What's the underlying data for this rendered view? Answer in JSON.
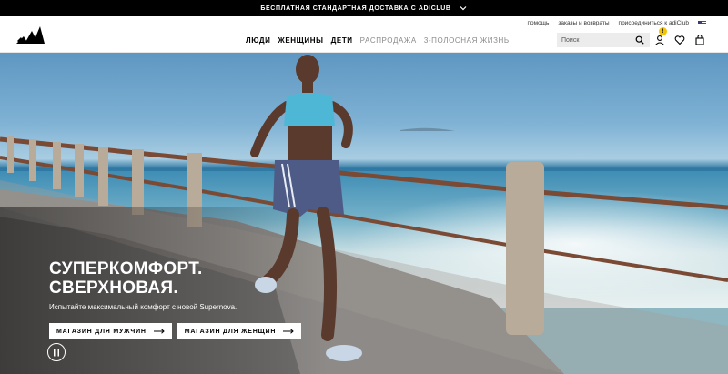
{
  "promo": {
    "text": "БЕСПЛАТНАЯ СТАНДАРТНАЯ ДОСТАВКА С ADICLUB",
    "icon": "chevron-down-icon"
  },
  "header": {
    "logo": "adidas-logo",
    "utility": [
      "помощь",
      "заказы и возвраты",
      "присоединиться к adiClub"
    ],
    "nav": [
      "ЛЮДИ",
      "ЖЕНЩИНЫ",
      "ДЕТИ",
      "РАСПРОДАЖА",
      "3-ПОЛОСНАЯ ЖИЗНЬ"
    ],
    "search_placeholder": "Поиск",
    "badge": "!"
  },
  "hero": {
    "headline_1": "СУПЕРКОМФОРТ.",
    "headline_2": "СВЕРХНОВАЯ.",
    "subtitle": "Испытайте максимальный комфорт с новой Supernova.",
    "cta_men": "МАГАЗИН ДЛЯ МУЖЧИН",
    "cta_women": "МАГАЗИН ДЛЯ ЖЕНЩИН"
  },
  "colors": {
    "promo_bg": "#000000",
    "accent_badge": "#f5c400"
  }
}
